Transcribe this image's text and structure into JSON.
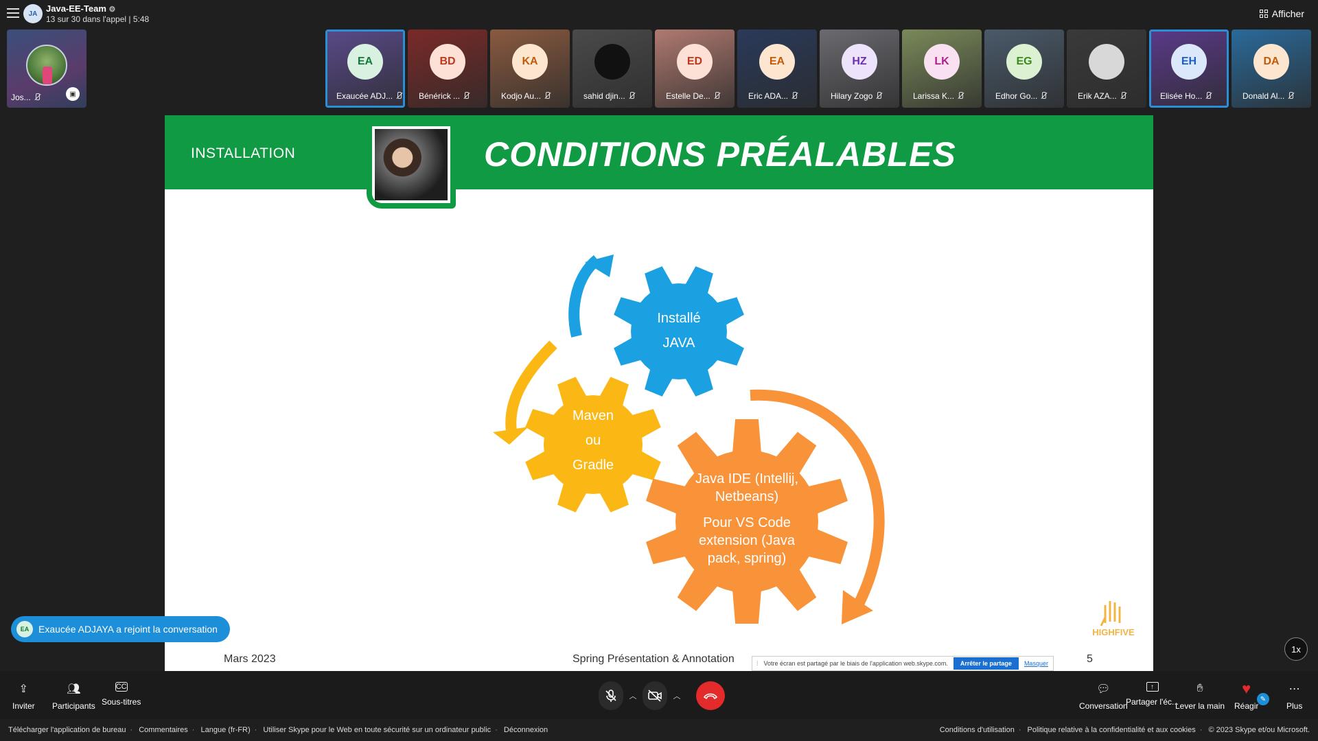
{
  "call": {
    "avatar_initials": "JA",
    "title": "Java-EE-Team",
    "subtitle": "13 sur 30 dans l'appel | 5:48",
    "afficher_label": "Afficher"
  },
  "self_tile": {
    "name": "Jos..."
  },
  "participants": [
    {
      "initials": "EA",
      "name": "Exaucée ADJ...",
      "bg": "#5a4a8a",
      "av_bg": "#d8f1e1",
      "av_fg": "#117a3a",
      "active": true
    },
    {
      "initials": "BD",
      "name": "Bénérick ...",
      "bg": "#7a2a28",
      "av_bg": "#fde0d6",
      "av_fg": "#c0381b",
      "active": false
    },
    {
      "initials": "KA",
      "name": "Kodjo Au...",
      "bg": "#8a5a40",
      "av_bg": "#fde6cf",
      "av_fg": "#c25a0a",
      "active": false
    },
    {
      "initials": "",
      "name": "sahid djin...",
      "bg": "#4a4a4a",
      "av_bg": "#111111",
      "av_fg": "#ffffff",
      "active": false
    },
    {
      "initials": "ED",
      "name": "Estelle De...",
      "bg": "#b07a70",
      "av_bg": "#fde0d6",
      "av_fg": "#c0381b",
      "active": false
    },
    {
      "initials": "EA",
      "name": "Eric ADA...",
      "bg": "#2a3a5a",
      "av_bg": "#fde6cf",
      "av_fg": "#c25a0a",
      "active": false
    },
    {
      "initials": "HZ",
      "name": "Hilary Zogo",
      "bg": "#6a6a70",
      "av_bg": "#ede3fa",
      "av_fg": "#6b2fb3",
      "active": false
    },
    {
      "initials": "LK",
      "name": "Larissa K...",
      "bg": "#7a8a5a",
      "av_bg": "#f9e1f1",
      "av_fg": "#b0208a",
      "active": false
    },
    {
      "initials": "EG",
      "name": "Edhor Go...",
      "bg": "#4a5a6a",
      "av_bg": "#dcf1d2",
      "av_fg": "#3a8a1a",
      "active": false
    },
    {
      "initials": "",
      "name": "Erik AZA...",
      "bg": "#3a3a3a",
      "av_bg": "#d8d8d8",
      "av_fg": "#333333",
      "active": false
    },
    {
      "initials": "EH",
      "name": "Elisée Ho...",
      "bg": "#5a3a8a",
      "av_bg": "#dbe8fb",
      "av_fg": "#1d5fbf",
      "active": true
    },
    {
      "initials": "DA",
      "name": "Donald Al...",
      "bg": "#2a6a9a",
      "av_bg": "#fde6cf",
      "av_fg": "#c25a0a",
      "active": false
    }
  ],
  "slide": {
    "section": "INSTALLATION",
    "title": "CONDITIONS PRÉALABLES",
    "gear_blue": [
      "Installé",
      "JAVA"
    ],
    "gear_yellow": [
      "Maven",
      "ou",
      "Gradle"
    ],
    "gear_orange_1": [
      "Java IDE (Intellij,",
      "Netbeans)"
    ],
    "gear_orange_2": [
      "Pour VS Code",
      "extension (Java",
      "pack, spring)"
    ],
    "footer_date": "Mars 2023",
    "footer_center": "Spring Présentation & Annotation",
    "page_number": "5",
    "logo_text": "HIGHFIVE",
    "colors": {
      "green": "#109a44",
      "blue": "#1ba1e2",
      "yellow": "#fbb814",
      "orange": "#f9933a"
    }
  },
  "share_bar": {
    "text": "Votre écran est partagé par le biais de l'application web.skype.com.",
    "stop_label": "Arrêter le partage",
    "hide_label": "Masquer"
  },
  "toast": {
    "initials": "EA",
    "text": "Exaucée ADJAYA a rejoint la conversation"
  },
  "speed_label": "1x",
  "bottom_bar": {
    "inviter": "Inviter",
    "participants": "Participants",
    "subtitles": "Sous-titres",
    "conversation": "Conversation",
    "share": "Partager l'éc...",
    "raise_hand": "Lever la main",
    "react": "Réagir",
    "more": "Plus"
  },
  "footer": {
    "left": [
      "Télécharger l'application de bureau",
      "Commentaires",
      "Langue (fr-FR)",
      "Utiliser Skype pour le Web en toute sécurité sur un ordinateur public",
      "Déconnexion"
    ],
    "right": [
      "Conditions d'utilisation",
      "Politique relative à la confidentialité et aux cookies",
      "© 2023 Skype et/ou Microsoft."
    ]
  }
}
